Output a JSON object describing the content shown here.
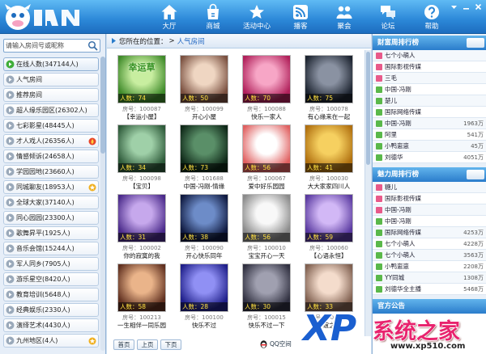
{
  "nav": [
    {
      "label": "大厅",
      "icon": "home-icon"
    },
    {
      "label": "商城",
      "icon": "shop-icon"
    },
    {
      "label": "活动中心",
      "icon": "activity-icon"
    },
    {
      "label": "播客",
      "icon": "rss-icon"
    },
    {
      "label": "聚会",
      "icon": "party-icon"
    },
    {
      "label": "论坛",
      "icon": "forum-icon"
    },
    {
      "label": "帮助",
      "icon": "help-icon"
    }
  ],
  "window_controls": [
    "menu-down-icon",
    "minimize-icon",
    "close-icon"
  ],
  "sidebar": {
    "search_placeholder": "请输入房间号或昵称",
    "items": [
      {
        "label": "在线人数(347144人)",
        "active": true
      },
      {
        "label": "人气房间"
      },
      {
        "label": "推荐房间"
      },
      {
        "label": "超人缘乐园区(26302人)"
      },
      {
        "label": "七彩影星(48445人)"
      },
      {
        "label": "才人戏人(26356人)",
        "badge": "flame-icon"
      },
      {
        "label": "情感倾诉(24658人)"
      },
      {
        "label": "学园园地(23660人)"
      },
      {
        "label": "同城聊友(18953人)",
        "badge": "star-icon"
      },
      {
        "label": "全球大家(37140人)"
      },
      {
        "label": "同心园园(23300人)"
      },
      {
        "label": "歌舞昇平(1925人)"
      },
      {
        "label": "音乐会馆(15244人)"
      },
      {
        "label": "军人同乡(7905人)"
      },
      {
        "label": "游乐星空(8420人)"
      },
      {
        "label": "教育培训(5648人)"
      },
      {
        "label": "经典娱乐(2330人)"
      },
      {
        "label": "演绎艺术(4430人)"
      },
      {
        "label": "九州地区(4人)",
        "badge": "star-icon"
      }
    ]
  },
  "breadcrumb": {
    "prefix": "您所在的位置：",
    "separator": ">",
    "current": "人气房间"
  },
  "rooms": [
    {
      "count": "人数：74",
      "id": "房号：100087",
      "name": "【幸运小屋】",
      "thumb_text": "幸运草",
      "colors": [
        "#c8eea0",
        "#3f8a2a"
      ]
    },
    {
      "count": "人数：50",
      "id": "房号：100099",
      "name": "开心小屋",
      "colors": [
        "#efd6c2",
        "#7a5040"
      ]
    },
    {
      "count": "人数：70",
      "id": "房号：100088",
      "name": "快乐一家人",
      "colors": [
        "#f7a6c6",
        "#b0205a"
      ]
    },
    {
      "count": "人数：75",
      "id": "房号：100078",
      "name": "有心缘来在一起",
      "colors": [
        "#8a92a2",
        "#1d2430"
      ]
    },
    {
      "count": "人数：34",
      "id": "房号：100098",
      "name": "【宝贝】",
      "colors": [
        "#9fd0a8",
        "#2e5a3a"
      ]
    },
    {
      "count": "人数：73",
      "id": "房号：101688",
      "name": "中国-冯刚-情缘",
      "colors": [
        "#5a8f68",
        "#0f2818"
      ]
    },
    {
      "count": "人数：56",
      "id": "房号：100067",
      "name": "爱中好乐园园",
      "colors": [
        "#ffffff",
        "#e06060"
      ]
    },
    {
      "count": "人数：41",
      "id": "房号：100030",
      "name": "大大家家四川人",
      "colors": [
        "#f6d060",
        "#b07010"
      ]
    },
    {
      "count": "人数：31",
      "id": "房号：100002",
      "name": "你的寂寞的我",
      "colors": [
        "#c6a8ec",
        "#4a2a8a"
      ]
    },
    {
      "count": "人数：38",
      "id": "房号：100090",
      "name": "开心快乐同年",
      "colors": [
        "#6d8cc8",
        "#101a40"
      ]
    },
    {
      "count": "人数：56",
      "id": "房号：100010",
      "name": "宝宝开心一天",
      "colors": [
        "#f8f8f8",
        "#8a8a8a"
      ]
    },
    {
      "count": "人数：59",
      "id": "房号：100060",
      "name": "【心语永恒】",
      "colors": [
        "#d2b8f6",
        "#5a3aa0"
      ]
    },
    {
      "count": "人数：58",
      "id": "房号：100213",
      "name": "一生相伴一同乐园",
      "colors": [
        "#eab48a",
        "#603020"
      ]
    },
    {
      "count": "人数：28",
      "id": "房号：100100",
      "name": "快乐不过",
      "colors": [
        "#9090f4",
        "#20208a"
      ]
    },
    {
      "count": "人数：30",
      "id": "房号：100015",
      "name": "快乐不过一下",
      "colors": [
        "#a0a0b0",
        "#303040"
      ]
    },
    {
      "count": "人数：33",
      "id": "房号：100077",
      "name": "友谊之家",
      "colors": [
        "#f4dccc",
        "#806050"
      ]
    }
  ],
  "pager": [
    "首页",
    "上页",
    "下页"
  ],
  "share": {
    "label": "QQ空间"
  },
  "ranks": [
    {
      "title": "财富周排行榜",
      "rows": [
        {
          "name": "七个小萌人",
          "value": "",
          "marker": "#e85a8a"
        },
        {
          "name": "国际影视传媒",
          "value": "",
          "marker": "#e85a8a"
        },
        {
          "name": "三毛",
          "value": "",
          "marker": "#e85a8a"
        },
        {
          "name": "中国-冯刚",
          "value": "",
          "marker": "#5ab84a"
        },
        {
          "name": "楚儿",
          "value": "",
          "marker": "#5ab84a"
        },
        {
          "name": "国际网络传媒",
          "value": "",
          "marker": "#5ab84a"
        },
        {
          "name": "中国-冯刚",
          "value": "1963万",
          "marker": "#5ab84a"
        },
        {
          "name": "阿里",
          "value": "541万",
          "marker": "#5ab84a"
        },
        {
          "name": "小鸭崽崽",
          "value": "45万",
          "marker": "#5ab84a"
        },
        {
          "name": "刘德华",
          "value": "4051万",
          "marker": "#5ab84a"
        }
      ]
    },
    {
      "title": "魅力周排行榜",
      "rows": [
        {
          "name": "糖儿",
          "value": "",
          "marker": "#e85a8a"
        },
        {
          "name": "国际影视传媒",
          "value": "",
          "marker": "#e85a8a"
        },
        {
          "name": "中国-冯刚",
          "value": "",
          "marker": "#e85a8a"
        },
        {
          "name": "中国-冯刚",
          "value": "",
          "marker": "#5ab84a"
        },
        {
          "name": "国际网络传媒",
          "value": "4253万",
          "marker": "#5ab84a"
        },
        {
          "name": "七个小萌人",
          "value": "4228万",
          "marker": "#5ab84a"
        },
        {
          "name": "七个小萌人",
          "value": "3563万",
          "marker": "#5ab84a"
        },
        {
          "name": "小鸭崽崽",
          "value": "2208万",
          "marker": "#5ab84a"
        },
        {
          "name": "YY同城",
          "value": "1308万",
          "marker": "#5ab84a"
        },
        {
          "name": "刘德华全主播",
          "value": "5468万",
          "marker": "#5ab84a"
        }
      ]
    }
  ],
  "notice": {
    "title": "官方公告"
  },
  "watermark": {
    "logo": "XP",
    "brand": "系统之家",
    "url": "www.xp510.com"
  }
}
